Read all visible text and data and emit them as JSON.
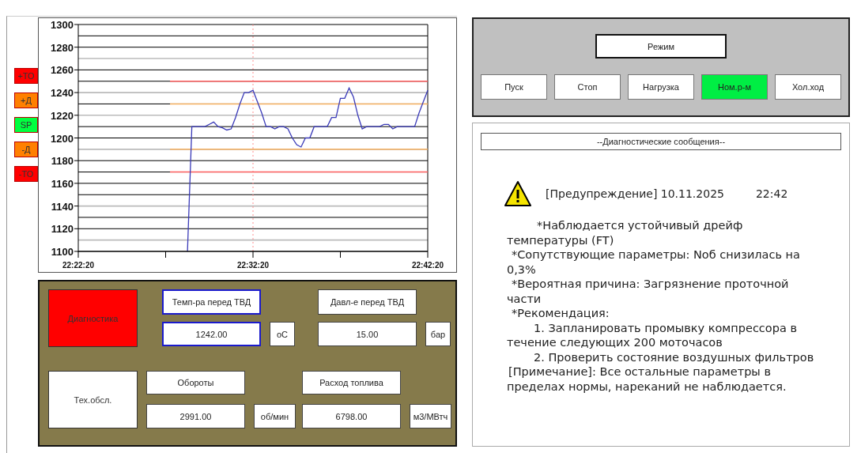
{
  "chart_panel": {
    "limit_badges": [
      {
        "label": "+ТО",
        "color": "#ff0000"
      },
      {
        "label": "+Д",
        "color": "#ff8000"
      },
      {
        "label": "SP",
        "color": "#00ff40"
      },
      {
        "label": "-Д",
        "color": "#ff8000"
      },
      {
        "label": "-ТО",
        "color": "#ff0000"
      }
    ],
    "chart_data": {
      "type": "line",
      "categories": [
        "22:22:20",
        null,
        null,
        null,
        null,
        null,
        null,
        null,
        null,
        null,
        null,
        null,
        null,
        null,
        null,
        null,
        null,
        null,
        null,
        null,
        null,
        null,
        null,
        null,
        null,
        null,
        null,
        null,
        null,
        null,
        null,
        null,
        null,
        null,
        null,
        null,
        null,
        null,
        null,
        null,
        "22:32:20",
        null,
        null,
        null,
        null,
        null,
        null,
        null,
        null,
        null,
        null,
        null,
        null,
        null,
        null,
        null,
        null,
        null,
        null,
        null,
        null,
        null,
        null,
        null,
        null,
        null,
        null,
        null,
        null,
        null,
        null,
        null,
        null,
        null,
        null,
        null,
        null,
        null,
        null,
        null,
        "22:42:20"
      ],
      "series": [
        {
          "color": "#3a3ab8",
          "values": [
            null,
            null,
            null,
            null,
            null,
            null,
            null,
            null,
            null,
            null,
            null,
            null,
            null,
            null,
            null,
            null,
            null,
            null,
            null,
            null,
            null,
            null,
            null,
            null,
            null,
            1100,
            1210,
            1210,
            1210,
            1210,
            1212,
            1214,
            1210,
            1209,
            1207,
            1208,
            1218,
            1230,
            1240,
            1240,
            1242,
            1232,
            1222,
            1210,
            1210,
            1208,
            1210,
            1210,
            1208,
            1200,
            1194,
            1192,
            1200,
            1200,
            1210,
            1210,
            1210,
            1210,
            1218,
            1218,
            1235,
            1235,
            1244,
            1236,
            1220,
            1208,
            1210,
            1210,
            1210,
            1210,
            1212,
            1212,
            1208,
            1210,
            1210,
            1210,
            1210,
            1210,
            1222,
            1232,
            1242
          ]
        },
        {
          "color": "#ff6060",
          "values": [
            null,
            null,
            null,
            null,
            null,
            null,
            null,
            null,
            null,
            null,
            null,
            null,
            null,
            null,
            null,
            null,
            null,
            null,
            null,
            null,
            null,
            1250,
            1250,
            1250,
            1250,
            1250,
            1250,
            1250,
            1250,
            1250,
            1250,
            1250,
            1250,
            1250,
            1250,
            1250,
            1250,
            1250,
            1250,
            1250,
            1250,
            1250,
            1250,
            1250,
            1250,
            1250,
            1250,
            1250,
            1250,
            1250,
            1250,
            1250,
            1250,
            1250,
            1250,
            1250,
            1250,
            1250,
            1250,
            1250,
            1250,
            1250,
            1250,
            1250,
            1250,
            1250,
            1250,
            1250,
            1250,
            1250,
            1250,
            1250,
            1250,
            1250,
            1250,
            1250,
            1250,
            1250,
            1250,
            1250,
            1250
          ]
        },
        {
          "color": "#f5b060",
          "values": [
            null,
            null,
            null,
            null,
            null,
            null,
            null,
            null,
            null,
            null,
            null,
            null,
            null,
            null,
            null,
            null,
            null,
            null,
            null,
            null,
            null,
            1230,
            1230,
            1230,
            1230,
            1230,
            1230,
            1230,
            1230,
            1230,
            1230,
            1230,
            1230,
            1230,
            1230,
            1230,
            1230,
            1230,
            1230,
            1230,
            1230,
            1230,
            1230,
            1230,
            1230,
            1230,
            1230,
            1230,
            1230,
            1230,
            1230,
            1230,
            1230,
            1230,
            1230,
            1230,
            1230,
            1230,
            1230,
            1230,
            1230,
            1230,
            1230,
            1230,
            1230,
            1230,
            1230,
            1230,
            1230,
            1230,
            1230,
            1230,
            1230,
            1230,
            1230,
            1230,
            1230,
            1230,
            1230,
            1230,
            1230
          ]
        },
        {
          "color": "#f5b060",
          "values": [
            null,
            null,
            null,
            null,
            null,
            null,
            null,
            null,
            null,
            null,
            null,
            null,
            null,
            null,
            null,
            null,
            null,
            null,
            null,
            null,
            null,
            1190,
            1190,
            1190,
            1190,
            1190,
            1190,
            1190,
            1190,
            1190,
            1190,
            1190,
            1190,
            1190,
            1190,
            1190,
            1190,
            1190,
            1190,
            1190,
            1190,
            1190,
            1190,
            1190,
            1190,
            1190,
            1190,
            1190,
            1190,
            1190,
            1190,
            1190,
            1190,
            1190,
            1190,
            1190,
            1190,
            1190,
            1190,
            1190,
            1190,
            1190,
            1190,
            1190,
            1190,
            1190,
            1190,
            1190,
            1190,
            1190,
            1190,
            1190,
            1190,
            1190,
            1190,
            1190,
            1190,
            1190,
            1190,
            1190,
            1190
          ]
        },
        {
          "color": "#ff6060",
          "values": [
            null,
            null,
            null,
            null,
            null,
            null,
            null,
            null,
            null,
            null,
            null,
            null,
            null,
            null,
            null,
            null,
            null,
            null,
            null,
            null,
            null,
            1170,
            1170,
            1170,
            1170,
            1170,
            1170,
            1170,
            1170,
            1170,
            1170,
            1170,
            1170,
            1170,
            1170,
            1170,
            1170,
            1170,
            1170,
            1170,
            1170,
            1170,
            1170,
            1170,
            1170,
            1170,
            1170,
            1170,
            1170,
            1170,
            1170,
            1170,
            1170,
            1170,
            1170,
            1170,
            1170,
            1170,
            1170,
            1170,
            1170,
            1170,
            1170,
            1170,
            1170,
            1170,
            1170,
            1170,
            1170,
            1170,
            1170,
            1170,
            1170,
            1170,
            1170,
            1170,
            1170,
            1170,
            1170,
            1170,
            1170
          ]
        }
      ],
      "grid": true,
      "ylim": [
        1100,
        1300
      ],
      "yticks": [
        1100,
        1120,
        1140,
        1160,
        1180,
        1200,
        1220,
        1240,
        1260,
        1280,
        1300
      ]
    }
  },
  "control_panel": {
    "buttons": [
      {
        "label": "Диагностика",
        "alarm": true
      },
      {
        "label": "Тех.обсл.",
        "alarm": false
      }
    ],
    "parameters": [
      {
        "label": "Темп-ра перед ТВД",
        "value": "1242.00",
        "unit": "оС",
        "highlighted": true
      },
      {
        "label": "Давл-е перед ТВД",
        "value": "15.00",
        "unit": "бар",
        "highlighted": false
      },
      {
        "label": "Обороты",
        "value": "2991.00",
        "unit": "об/мин",
        "highlighted": false
      },
      {
        "label": "Расход топлива",
        "value": "6798.00",
        "unit": "м3/МВтч",
        "highlighted": false
      }
    ]
  },
  "mode_panel": {
    "title": "Режим",
    "buttons": [
      {
        "label": "Пуск",
        "selected": false
      },
      {
        "label": "Стоп",
        "selected": false
      },
      {
        "label": "Нагрузка",
        "selected": false
      },
      {
        "label": "Ном.р-м",
        "selected": true
      },
      {
        "label": "Хол.ход",
        "selected": false
      }
    ]
  },
  "diagnostics": {
    "header": "--Диагностические сообщения--",
    "title": "[Предупреждение] 10.11.2025",
    "time": "22:42",
    "lines": [
      {
        "kind": "lead",
        "text": "*Наблюдается устойчивый дрейф температуры (FT)"
      },
      {
        "kind": "bullet",
        "text": "*Сопутствующие параметры: Nоб снизилась на 0,3%"
      },
      {
        "kind": "bullet",
        "text": "*Вероятная причина: Загрязнение проточной части"
      },
      {
        "kind": "bullet",
        "text": "*Рекомендация:"
      },
      {
        "kind": "step",
        "text": "1. Запланировать промывку компрессора в течение следующих 200 моточасов"
      },
      {
        "kind": "step",
        "text": "2. Проверить состояние воздушных фильтров"
      },
      {
        "kind": "note",
        "text": "[Примечание]: Все остальные параметры в пределах нормы, нареканий не наблюдается."
      }
    ]
  }
}
